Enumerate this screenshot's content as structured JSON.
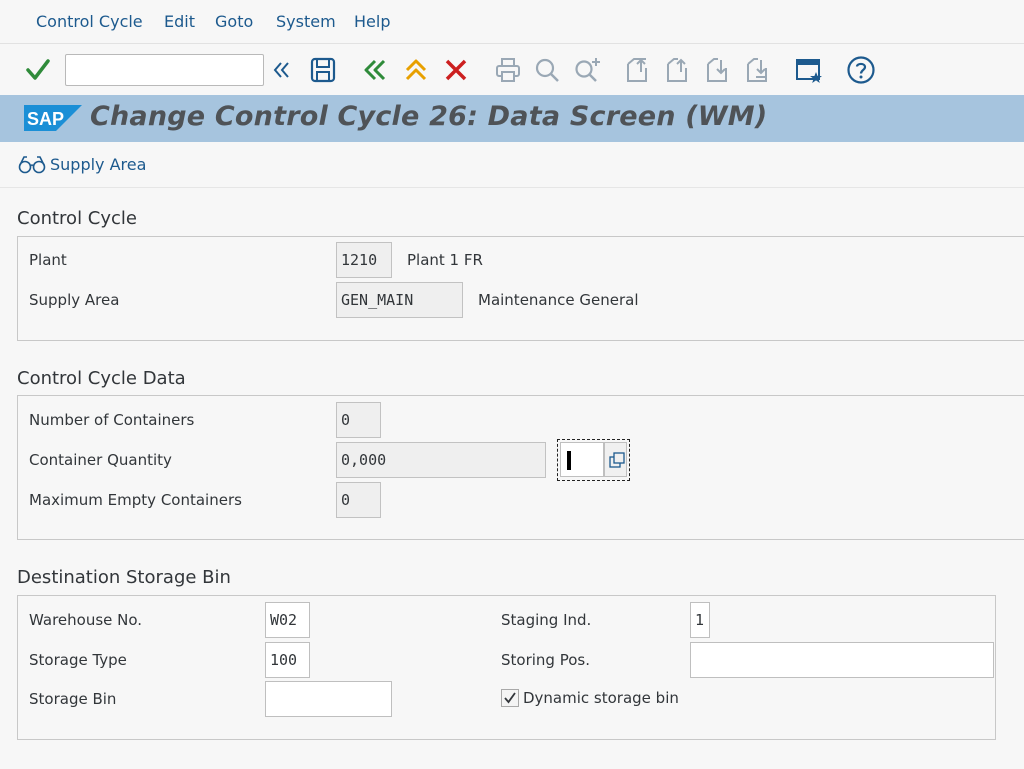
{
  "menu": [
    "Control Cycle",
    "Edit",
    "Goto",
    "System",
    "Help"
  ],
  "toolbar": {
    "command_value": "",
    "icons": [
      "check-icon",
      "double-left-icon",
      "save-icon",
      "back-icon",
      "exit-icon",
      "cancel-icon",
      "print-icon",
      "find-icon",
      "find-next-icon",
      "first-page-icon",
      "prev-page-icon",
      "next-page-icon",
      "last-page-icon",
      "new-session-icon",
      "help-icon"
    ],
    "colors": {
      "check": "#2f8b3a",
      "back": "#2f8b3a",
      "exit": "#e8a000",
      "cancel": "#cc1f1f",
      "icon": "#1d5a8e",
      "disabled": "#9aa8b5"
    }
  },
  "title": {
    "logo_text": "SAP",
    "text": "Change Control Cycle 26: Data Screen (WM)",
    "bar_color": "#a6c4de"
  },
  "app_toolbar": {
    "supply_area": "Supply Area"
  },
  "control_cycle": {
    "heading": "Control Cycle",
    "plant_label": "Plant",
    "plant_value": "1210",
    "plant_desc": "Plant 1 FR",
    "supply_area_label": "Supply Area",
    "supply_area_value": "GEN_MAIN",
    "supply_area_desc": "Maintenance General"
  },
  "control_cycle_data": {
    "heading": "Control Cycle Data",
    "num_containers_label": "Number of Containers",
    "num_containers_value": "0",
    "container_qty_label": "Container Quantity",
    "container_qty_value": "0,000",
    "unit_value": "",
    "max_empty_label": "Maximum Empty Containers",
    "max_empty_value": "0"
  },
  "destination": {
    "heading": "Destination Storage Bin",
    "warehouse_label": "Warehouse No.",
    "warehouse_value": "W02",
    "storage_type_label": "Storage Type",
    "storage_type_value": "100",
    "storage_bin_label": "Storage Bin",
    "storage_bin_value": "",
    "staging_label": "Staging Ind.",
    "staging_value": "1",
    "storing_pos_label": "Storing Pos.",
    "storing_pos_value": "",
    "dynamic_bin_label": "Dynamic storage bin",
    "dynamic_bin_checked": true
  }
}
